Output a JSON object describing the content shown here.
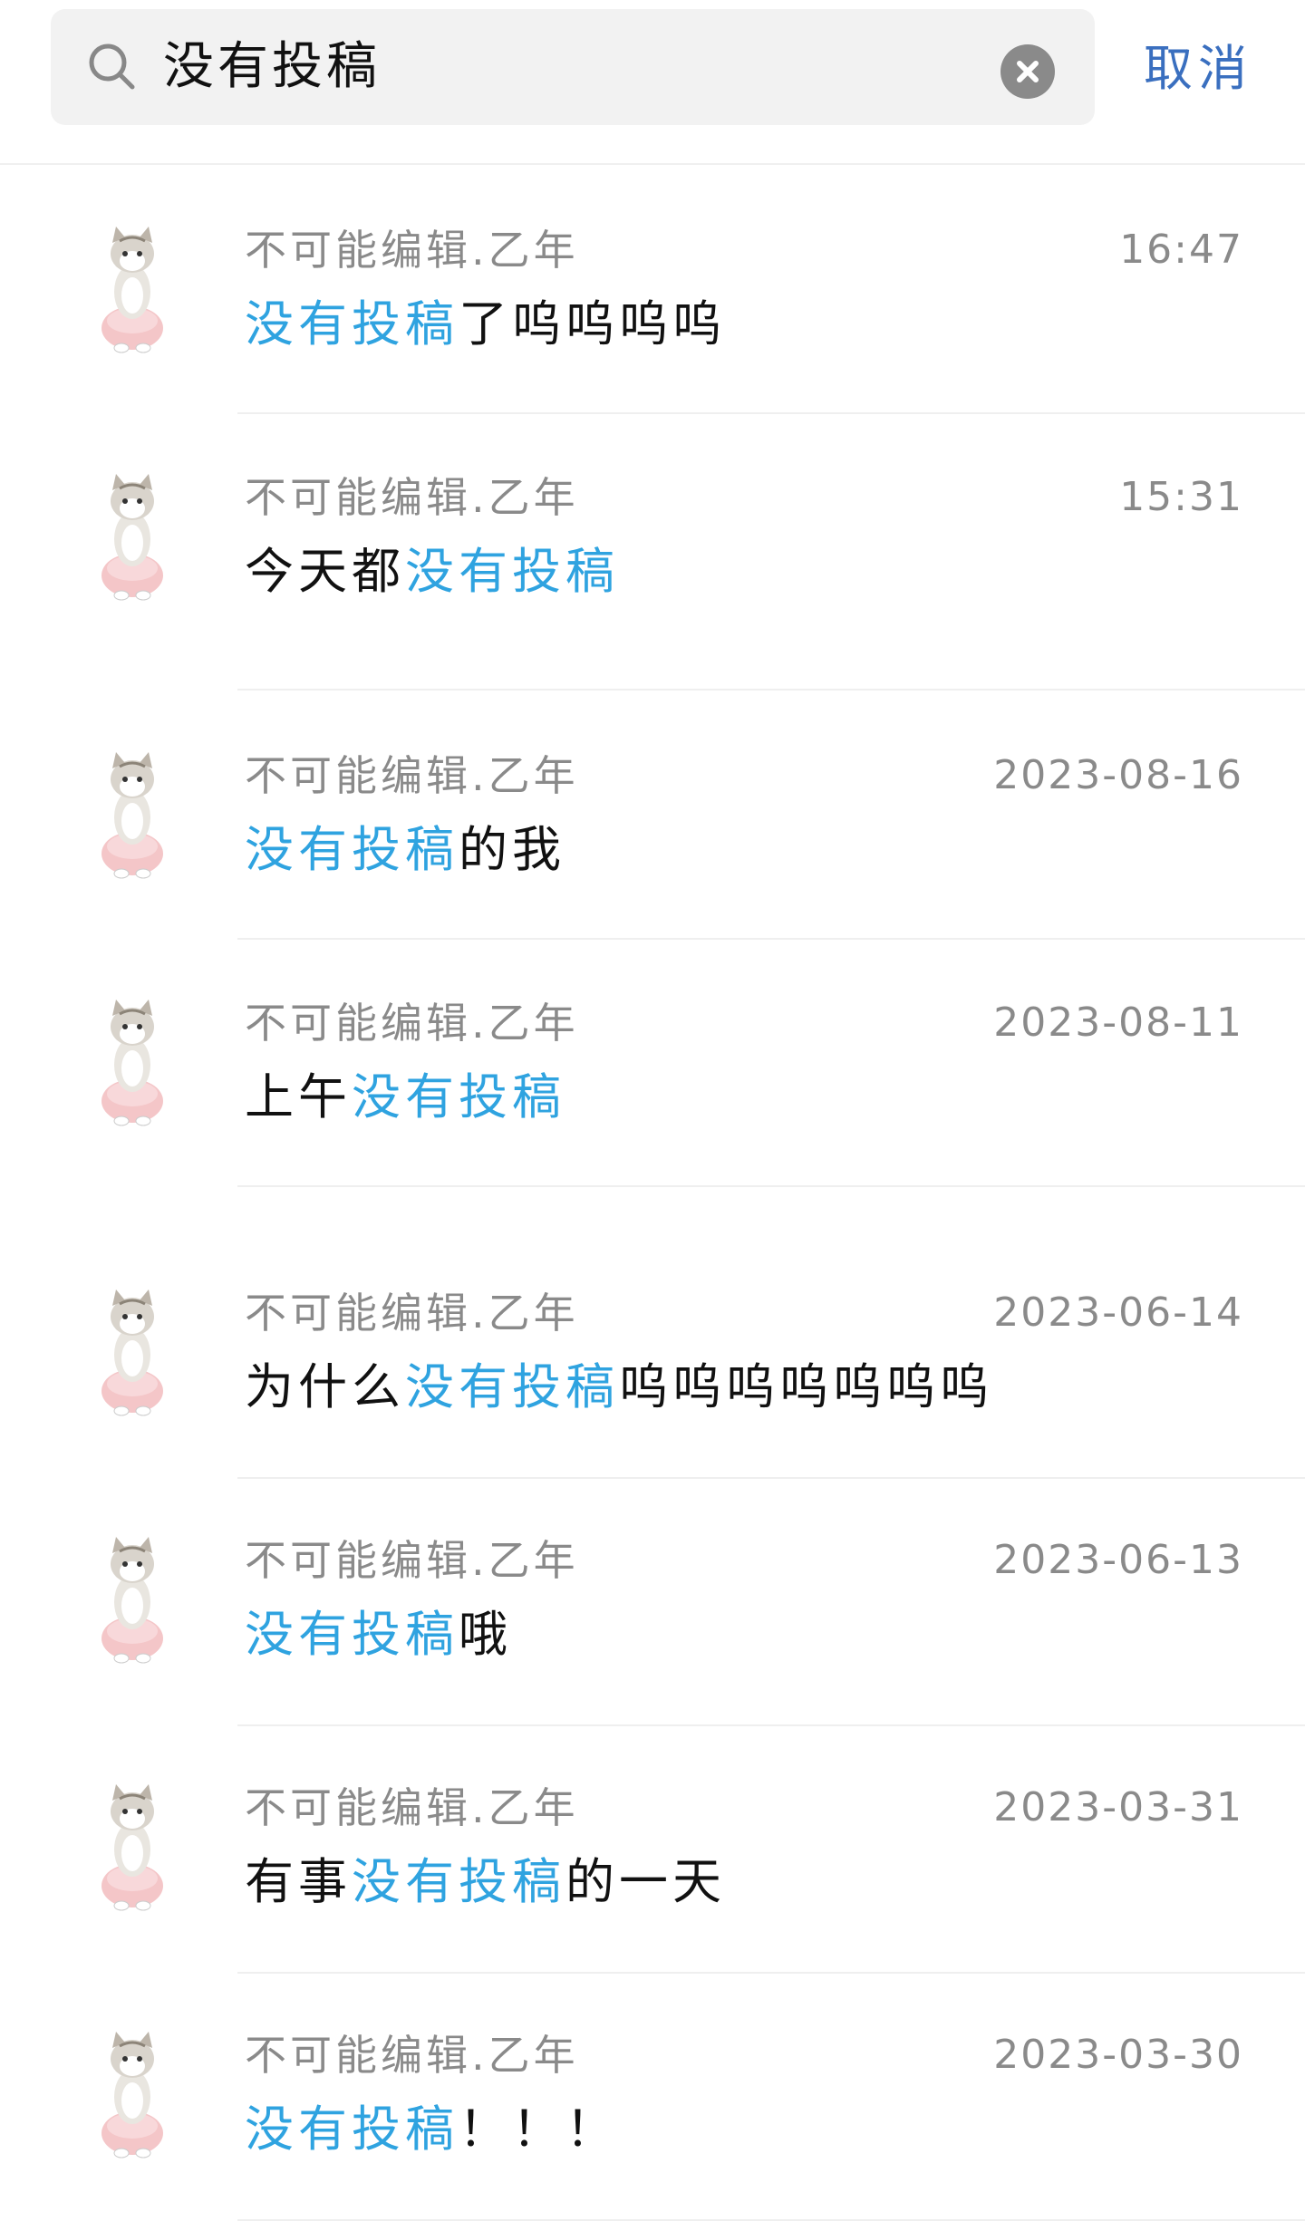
{
  "search": {
    "query": "没有投稿",
    "cancel_label": "取消"
  },
  "colors": {
    "highlight": "#2fa3e0",
    "cancel": "#3a6fbf",
    "meta": "#8a8a8a"
  },
  "results": [
    {
      "sender": "不可能编辑.乙年",
      "time": "16:47",
      "pre": "",
      "match": "没有投稿",
      "post": "了呜呜呜呜"
    },
    {
      "sender": "不可能编辑.乙年",
      "time": "15:31",
      "pre": "今天都",
      "match": "没有投稿",
      "post": ""
    },
    {
      "sender": "不可能编辑.乙年",
      "time": "2023-08-16",
      "pre": "",
      "match": "没有投稿",
      "post": "的我"
    },
    {
      "sender": "不可能编辑.乙年",
      "time": "2023-08-11",
      "pre": "上午",
      "match": "没有投稿",
      "post": ""
    },
    {
      "sender": "不可能编辑.乙年",
      "time": "2023-06-14",
      "pre": "为什么",
      "match": "没有投稿",
      "post": "呜呜呜呜呜呜呜"
    },
    {
      "sender": "不可能编辑.乙年",
      "time": "2023-06-13",
      "pre": "",
      "match": "没有投稿",
      "post": "哦"
    },
    {
      "sender": "不可能编辑.乙年",
      "time": "2023-03-31",
      "pre": "有事",
      "match": "没有投稿",
      "post": "的一天"
    },
    {
      "sender": "不可能编辑.乙年",
      "time": "2023-03-30",
      "pre": "",
      "match": "没有投稿",
      "post": "！！！"
    }
  ]
}
